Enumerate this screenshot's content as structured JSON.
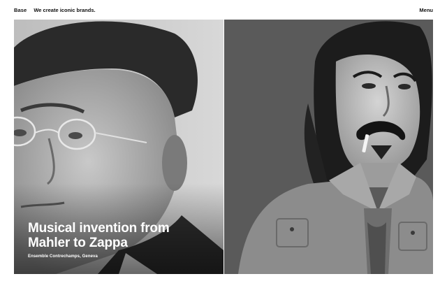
{
  "header": {
    "brand": "Base",
    "tagline": "We create iconic brands.",
    "menu_label": "Menu"
  },
  "hero": {
    "headline": "Musical invention from Mahler to Zappa",
    "subtitle": "Ensemble Contrechamps, Geneva",
    "left_image": "portrait-mahler",
    "right_image": "portrait-zappa"
  }
}
